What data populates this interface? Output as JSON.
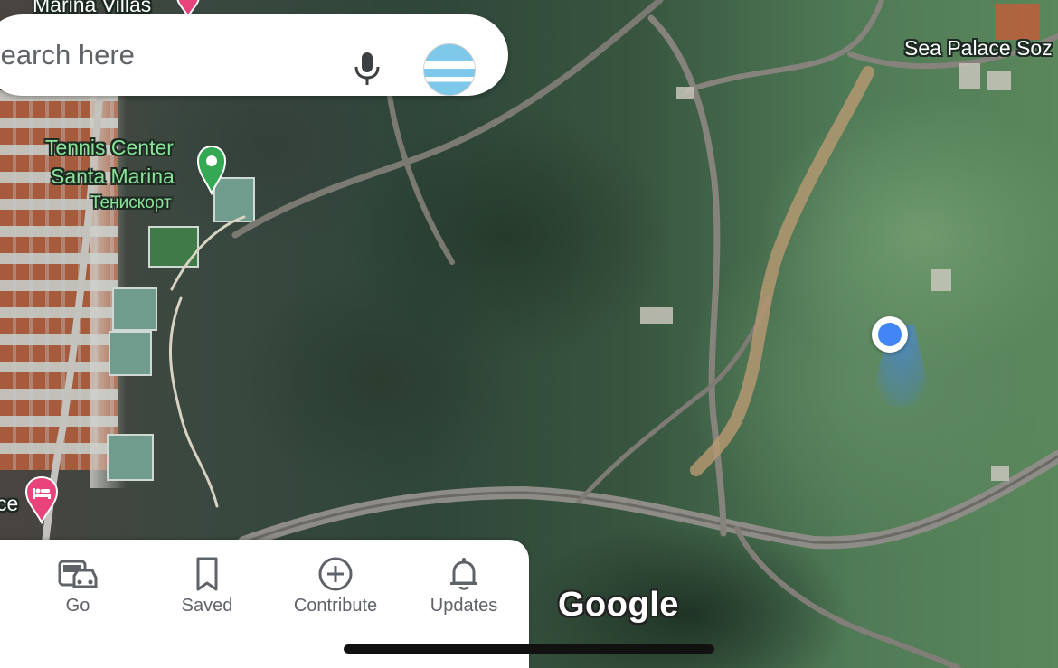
{
  "search": {
    "placeholder": "Search here",
    "mic_icon": "microphone-icon",
    "avatar_icon": "profile-avatar"
  },
  "map": {
    "labels": {
      "top_place": "Marina Villas",
      "tennis_line1": "Tennis Center",
      "tennis_line2": "Santa Marina",
      "tennis_local": "Тенискорт",
      "sea_palace": "Sea Palace Soz",
      "hotel_partial": "ce"
    },
    "pins": [
      "pink-place-pin",
      "green-tennis-pin",
      "pink-hotel-pin"
    ],
    "brand": "Google"
  },
  "bottom_nav": {
    "items": [
      {
        "label": "Go",
        "icon": "car-transit-icon"
      },
      {
        "label": "Saved",
        "icon": "bookmark-icon"
      },
      {
        "label": "Contribute",
        "icon": "add-circle-icon"
      },
      {
        "label": "Updates",
        "icon": "bell-icon"
      }
    ]
  },
  "colors": {
    "location_blue": "#4285f4",
    "pin_pink": "#e8437a",
    "pin_green": "#34a853",
    "label_green": "#8be39a",
    "nav_text": "#5f6368"
  }
}
